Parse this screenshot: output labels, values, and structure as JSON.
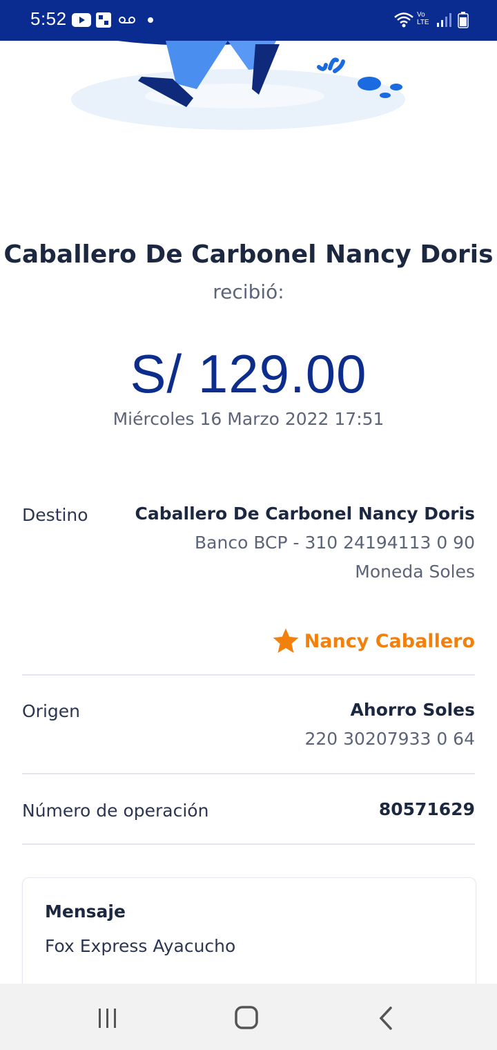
{
  "status_bar": {
    "time": "5:52",
    "icons": [
      "youtube-icon",
      "app-icon",
      "voicemail-icon",
      "dot-icon",
      "wifi-icon",
      "volte-icon",
      "signal-icon",
      "battery-icon"
    ],
    "network_label": "Vo LTE"
  },
  "receipt": {
    "receiver_name": "Caballero De Carbonel Nancy Doris",
    "received_label": "recibió:",
    "amount": "S/ 129.00",
    "datetime": "Miércoles 16 Marzo 2022 17:51"
  },
  "details": {
    "destino": {
      "label": "Destino",
      "name": "Caballero De Carbonel Nancy Doris",
      "bank_account": "Banco BCP - 310 24194113 0 90",
      "currency": "Moneda Soles"
    },
    "favorite": {
      "icon": "star-icon",
      "label": "Nancy Caballero",
      "color": "#f2800d"
    },
    "origen": {
      "label": "Origen",
      "account_type": "Ahorro Soles",
      "account_number": "220 30207933 0 64"
    },
    "operation": {
      "label": "Número de operación",
      "number": "80571629"
    }
  },
  "message": {
    "title": "Mensaje",
    "text": "Fox Express Ayacucho"
  },
  "nav_bar": {
    "buttons": [
      "recents-button",
      "home-button",
      "back-button"
    ]
  },
  "colors": {
    "brand_blue": "#0c2d8c",
    "status_bar": "#0a2b8f",
    "accent_orange": "#f2800d"
  }
}
